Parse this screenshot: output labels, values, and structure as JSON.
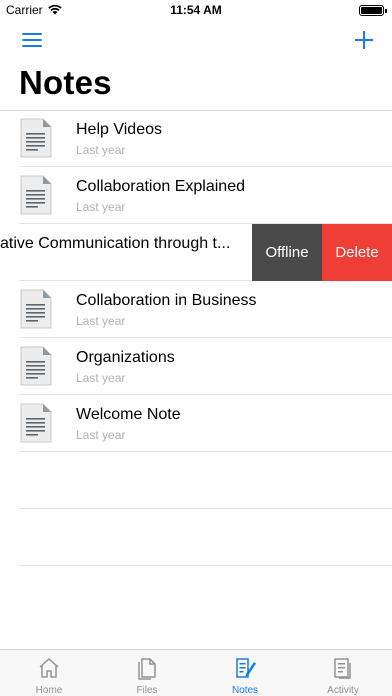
{
  "status_bar": {
    "carrier": "Carrier",
    "time": "11:54 AM"
  },
  "nav": {
    "title": "Notes",
    "menu_icon": "hamburger-menu-icon",
    "add_icon": "plus-icon"
  },
  "notes": [
    {
      "title": "Help Videos",
      "date": "Last year",
      "icon": "document-icon"
    },
    {
      "title": "Collaboration Explained",
      "date": "Last year",
      "icon": "document-icon"
    }
  ],
  "swiped_note": {
    "title": "ative Communication through t...",
    "actions": {
      "offline": "Offline",
      "delete": "Delete"
    }
  },
  "notes_after": [
    {
      "title": "Collaboration in Business",
      "date": "Last year",
      "icon": "document-icon"
    },
    {
      "title": "Organizations",
      "date": "Last year",
      "icon": "document-icon"
    },
    {
      "title": "Welcome Note",
      "date": "Last year",
      "icon": "document-icon"
    }
  ],
  "tab_bar": {
    "tabs": [
      {
        "label": "Home",
        "icon": "home-icon",
        "active": false
      },
      {
        "label": "Files",
        "icon": "files-icon",
        "active": false
      },
      {
        "label": "Notes",
        "icon": "notes-icon",
        "active": true
      },
      {
        "label": "Activity",
        "icon": "activity-icon",
        "active": false
      }
    ]
  },
  "colors": {
    "accent": "#1a7ae6",
    "offline_action": "#4a4a4a",
    "delete_action": "#ef3e36",
    "secondary_text": "#b3b3b3"
  }
}
